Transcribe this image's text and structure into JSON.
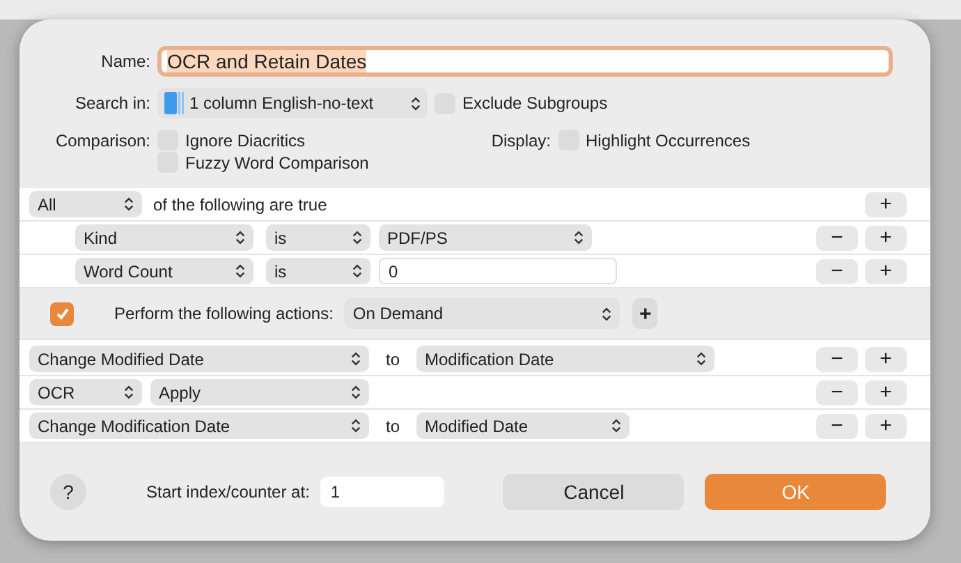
{
  "name": {
    "label": "Name:",
    "value": "OCR and Retain Dates",
    "focused": true
  },
  "search_in": {
    "label": "Search in:",
    "value": "1 column English-no-text",
    "exclude": {
      "label": "Exclude Subgroups",
      "checked": false
    }
  },
  "comparison": {
    "label": "Comparison:",
    "options": [
      {
        "label": "Ignore Diacritics",
        "checked": false
      },
      {
        "label": "Fuzzy Word Comparison",
        "checked": false
      }
    ]
  },
  "display": {
    "label": "Display:",
    "options": [
      {
        "label": "Highlight Occurrences",
        "checked": false
      }
    ]
  },
  "criteria": {
    "match": "All",
    "text": "of the following are true",
    "add": "+",
    "rows": [
      {
        "items": [
          {
            "kind": "popup-medium",
            "text": "Kind"
          },
          {
            "kind": "popup-short",
            "text": "is"
          },
          {
            "kind": "popup-mid",
            "text": "PDF/PS"
          }
        ],
        "remove": "−",
        "add": "+"
      },
      {
        "items": [
          {
            "kind": "popup-medium",
            "text": "Word Count"
          },
          {
            "kind": "popup-short",
            "text": "is"
          },
          {
            "kind": "field",
            "text": "0"
          }
        ],
        "remove": "−",
        "add": "+"
      }
    ]
  },
  "actions_bar": {
    "checked": true,
    "label": "Perform the following actions:",
    "trigger": "On Demand",
    "add": "+"
  },
  "actions": [
    {
      "items": [
        {
          "kind": "popup-long",
          "text": "Change Modified Date"
        },
        {
          "kind": "label",
          "text": "to"
        },
        {
          "kind": "popup-wide",
          "text": "Modification Date"
        }
      ],
      "remove": "−",
      "add": "+"
    },
    {
      "items": [
        {
          "kind": "popup-tiny",
          "text": "OCR"
        },
        {
          "kind": "popup-rest",
          "text": "Apply"
        }
      ],
      "remove": "−",
      "add": "+"
    },
    {
      "items": [
        {
          "kind": "popup-long",
          "text": "Change Modification Date"
        },
        {
          "kind": "label",
          "text": "to"
        },
        {
          "kind": "popup-mid",
          "text": "Modified Date"
        }
      ],
      "remove": "−",
      "add": "+"
    }
  ],
  "footer": {
    "help": "?",
    "counter_label": "Start index/counter at:",
    "counter": "1",
    "buttons": [
      {
        "label": "Cancel",
        "default": false
      },
      {
        "label": "OK",
        "default": true
      }
    ]
  }
}
